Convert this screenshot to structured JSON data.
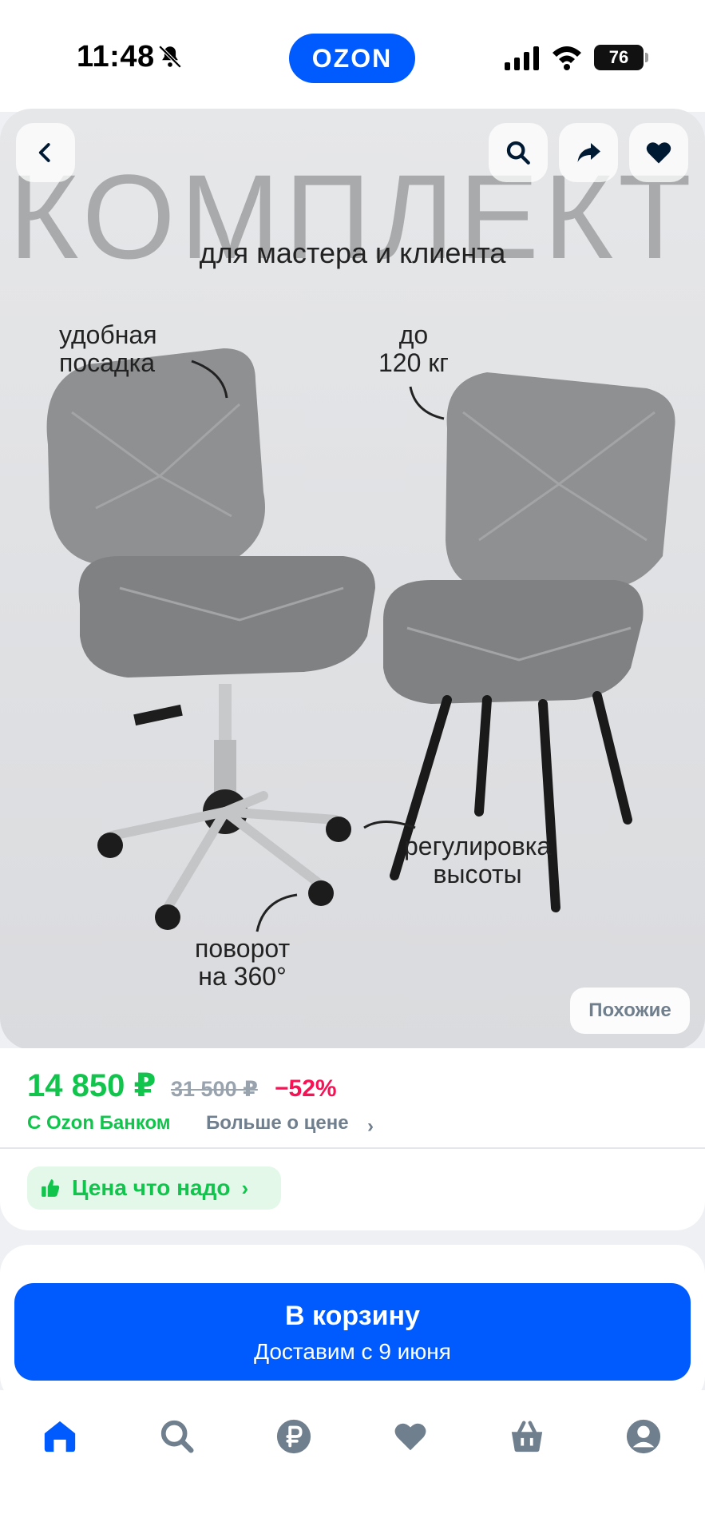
{
  "status_bar": {
    "time": "11:48",
    "battery": "76"
  },
  "brand": {
    "logo_text": "OZON",
    "accent_color": "#005bff"
  },
  "product_image": {
    "title": "КОМПЛЕКТ",
    "subtitle": "для мастера и клиента",
    "annotations": {
      "comfortable_seat": "удобная\nпосадка",
      "max_load": "до\n120 кг",
      "height_adjust": "регулировка\nвысоты",
      "rotation": "поворот\nна 360°"
    },
    "similar_label": "Похожие",
    "icons": [
      "back-icon",
      "search-icon",
      "share-icon",
      "heart-icon"
    ]
  },
  "price": {
    "current": "14 850 ₽",
    "old": "31 500 ₽",
    "discount": "−52%",
    "bank_label": "С Ozon Банком",
    "more_label": "Больше о цене",
    "more_chevron": "›",
    "good_price_label": "Цена что надо",
    "good_price_chevron": "›",
    "price_color": "#10c44c",
    "discount_color": "#f91155"
  },
  "cart": {
    "label": "В корзину",
    "delivery": "Доставим с 9 июня"
  },
  "bottom_nav": {
    "items": [
      "home-icon",
      "search-icon",
      "ruble-icon",
      "favorites-icon",
      "cart-icon",
      "profile-icon"
    ],
    "active_color": "#005bff",
    "inactive_color": "#707f8d"
  }
}
